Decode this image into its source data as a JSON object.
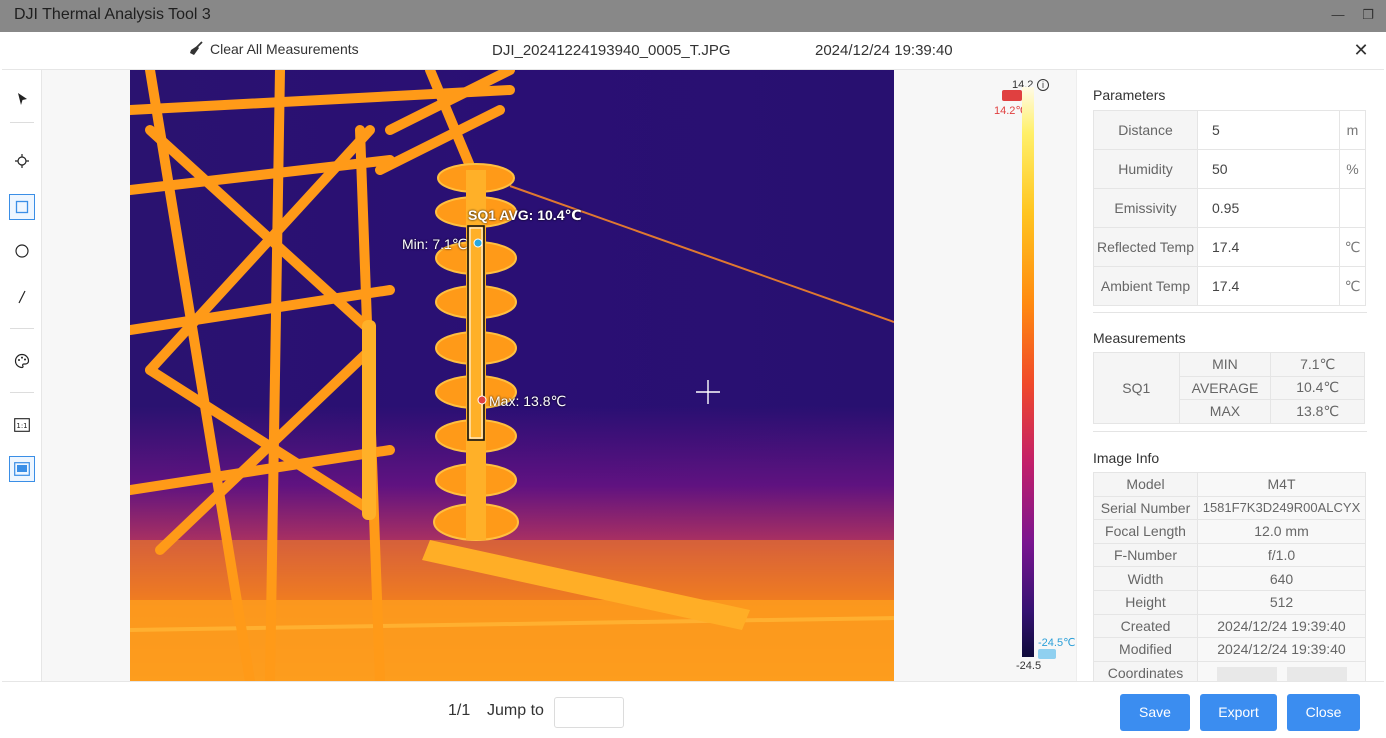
{
  "app": {
    "title": "DJI Thermal Analysis Tool 3"
  },
  "topbar": {
    "clear_label": "Clear All Measurements",
    "filename": "DJI_20241224193940_0005_T.JPG",
    "datetime": "2024/12/24 19:39:40"
  },
  "overlay": {
    "box_label": "SQ1 AVG: 10.4℃",
    "min_label": "Min: 7.1℃",
    "max_label": "Max: 13.8℃"
  },
  "scale": {
    "top_value": "14.2",
    "top_marker": "14.2℃",
    "bottom_value": "-24.5",
    "bottom_marker": "-24.5℃",
    "marker_top_color": "#e04040",
    "marker_bottom_color": "#2b9fd8"
  },
  "parameters": {
    "title": "Parameters",
    "rows": [
      {
        "label": "Distance",
        "value": "5",
        "unit": "m"
      },
      {
        "label": "Humidity",
        "value": "50",
        "unit": "%"
      },
      {
        "label": "Emissivity",
        "value": "0.95",
        "unit": ""
      },
      {
        "label": "Reflected Temp",
        "value": "17.4",
        "unit": "℃"
      },
      {
        "label": "Ambient Temp",
        "value": "17.4",
        "unit": "℃"
      }
    ]
  },
  "measurements": {
    "title": "Measurements",
    "name": "SQ1",
    "rows": [
      {
        "label": "MIN",
        "value": "7.1℃"
      },
      {
        "label": "AVERAGE",
        "value": "10.4℃"
      },
      {
        "label": "MAX",
        "value": "13.8℃"
      }
    ]
  },
  "image_info": {
    "title": "Image Info",
    "rows": [
      {
        "label": "Model",
        "value": "M4T"
      },
      {
        "label": "Serial Number",
        "value": "1581F7K3D249R00ALCYX"
      },
      {
        "label": "Focal Length",
        "value": "12.0 mm"
      },
      {
        "label": "F-Number",
        "value": "f/1.0"
      },
      {
        "label": "Width",
        "value": "640"
      },
      {
        "label": "Height",
        "value": "512"
      },
      {
        "label": "Created",
        "value": "2024/12/24 19:39:40"
      },
      {
        "label": "Modified",
        "value": "2024/12/24 19:39:40"
      },
      {
        "label": "Coordinates",
        "value": ""
      }
    ]
  },
  "bottom": {
    "pager": "1/1",
    "jump_label": "Jump to",
    "jump_value": "",
    "save_label": "Save",
    "export_label": "Export",
    "close_label": "Close"
  },
  "colors": {
    "accent": "#3b8df0",
    "titlebar": "#888888"
  }
}
